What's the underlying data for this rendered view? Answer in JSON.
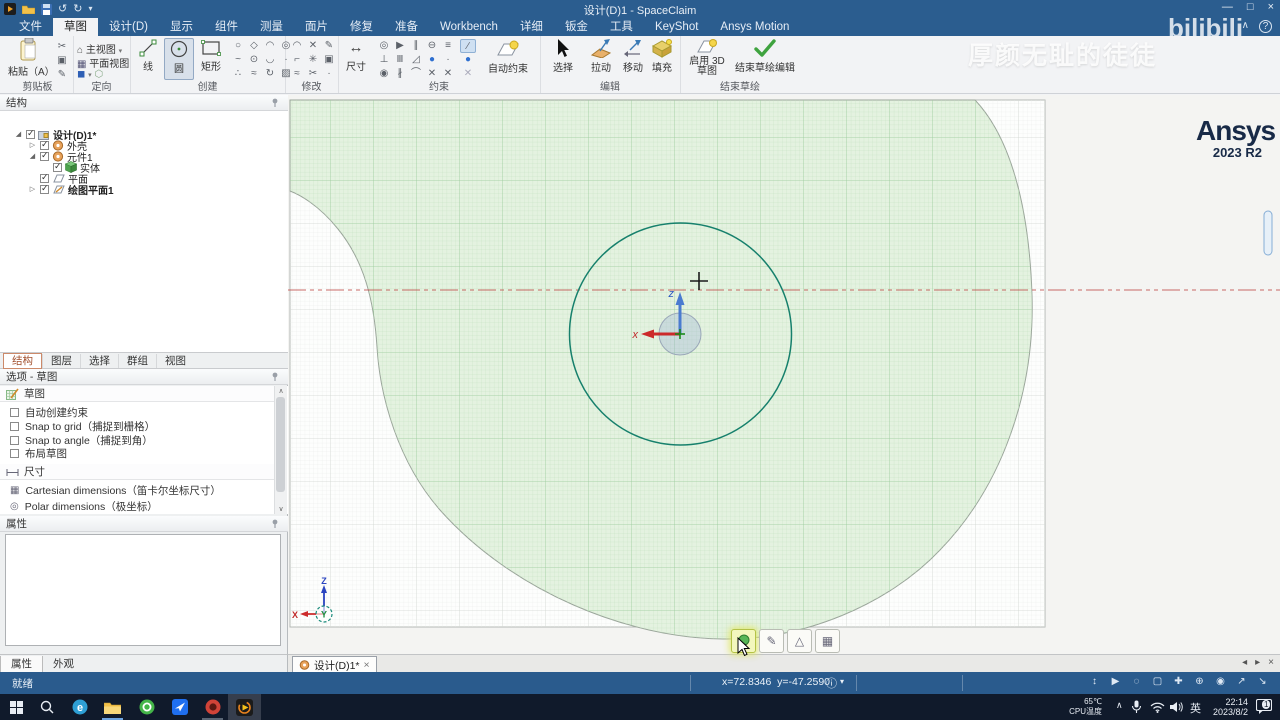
{
  "colors": {
    "titlebar": "#2b5d8f",
    "ribbon_bg": "#f2f3f5",
    "sketch_fill": "#e4f2e0",
    "sketch_circle": "#16806c",
    "centerline": "#c0504d",
    "statusbar": "#2a5b8d",
    "taskbar": "#101a2b"
  },
  "titlebar": {
    "title": "设计(D)1 - SpaceClaim",
    "controls": {
      "minimize": "—",
      "maximize": "□",
      "close": "×"
    }
  },
  "qat": {
    "undo": "↺",
    "redo": "↻",
    "more": "▾"
  },
  "menu": {
    "tabs": [
      "文件",
      "草图",
      "设计(D)",
      "显示",
      "组件",
      "测量",
      "面片",
      "修复",
      "准备",
      "Workbench",
      "详细",
      "钣金",
      "工具",
      "KeyShot",
      "Ansys Motion"
    ],
    "collapse": "∧",
    "help": "?"
  },
  "ribbon": {
    "groups": [
      "剪贴板",
      "定向",
      "创建",
      "修改",
      "约束",
      "编辑",
      "结束草绘"
    ],
    "paste_label": "粘贴（A）",
    "clipboard_side": [
      "✂",
      "▣",
      "✎"
    ],
    "orient": {
      "home": "主视图",
      "plan": "平面视图",
      "caret": "▾"
    },
    "create": {
      "line": "线",
      "circle": "圆",
      "rect": "矩形",
      "grid": [
        "○",
        "◇",
        "◠",
        "◎",
        "~",
        "⊙",
        "◡",
        "·",
        "∴",
        "≈",
        "↻",
        "▨"
      ]
    },
    "modify": {
      "grid": [
        "◠",
        "✕",
        "✎",
        "⌐",
        "✳",
        "▣",
        "≈",
        "✂",
        "·"
      ]
    },
    "constrain": {
      "dim": "尺寸",
      "dim_icon": "↔",
      "auto": "自动约束",
      "grid": [
        "◎",
        "▶",
        "∥",
        "⊖",
        "≡",
        "⊥",
        "Ⅲ",
        "◿",
        "●",
        "·",
        "◉",
        "∦",
        "⌒",
        "✕",
        "✕"
      ],
      "extra": [
        "∕",
        "●",
        "✕"
      ]
    },
    "edit": {
      "select": "选择",
      "pull": "拉动",
      "move": "移动",
      "fill": "填充",
      "caret": "▾"
    },
    "finish": {
      "enable3d": "启用 3D 草图",
      "end": "结束草绘编辑"
    }
  },
  "watermark": {
    "main": "厚颜无耻的徒徒",
    "corner": "bilibili"
  },
  "sidebar": {
    "structure_header": "结构",
    "tree": [
      {
        "label": "设计(D)1*"
      },
      {
        "label": "外壳"
      },
      {
        "label": "元件1"
      },
      {
        "label": "实体"
      },
      {
        "label": "平面"
      },
      {
        "label": "绘图平面1"
      }
    ],
    "tabs": [
      "结构",
      "图层",
      "选择",
      "群组",
      "视图"
    ],
    "options_header": "选项 - 草图",
    "sketch_section": "草图",
    "checkboxes": [
      "自动创建约束",
      "Snap to grid（捕捉到栅格）",
      "Snap to angle（捕捉到角）",
      "布局草图"
    ],
    "dim_section": "尺寸",
    "dim_items": [
      "Cartesian dimensions（笛卡尔坐标尺寸）",
      "Polar dimensions（极坐标）"
    ],
    "properties_header": "属性",
    "bottom_tabs": [
      "属性",
      "外观"
    ]
  },
  "docbar": {
    "tab": "设计(D)1*",
    "close": "×",
    "nav": [
      "◂",
      "▸",
      "×"
    ]
  },
  "canvas": {
    "logo_line1": "Ansys",
    "logo_line2": "2023 R2",
    "origin_z": "z",
    "origin_x": "x",
    "triad_z": "Z",
    "triad_x": "X",
    "triad_y": "Y",
    "mini_icons": [
      "✎",
      "△",
      "▦"
    ]
  },
  "statusbar": {
    "ready": "就绪",
    "coords": "x=72.8346  y=-47.2590",
    "info_icon": "ⓘ",
    "info_caret": "▾",
    "tools": [
      "↕",
      "▶",
      "◌",
      "▢",
      "✚",
      "⊕",
      "◉",
      "↗",
      "↘"
    ]
  },
  "taskbar": {
    "temp": "65℃",
    "temp_label": "CPU温度",
    "tray_chevron": "∧",
    "lang": "英",
    "time": "22:14",
    "date": "2023/8/2",
    "badge": "1"
  }
}
